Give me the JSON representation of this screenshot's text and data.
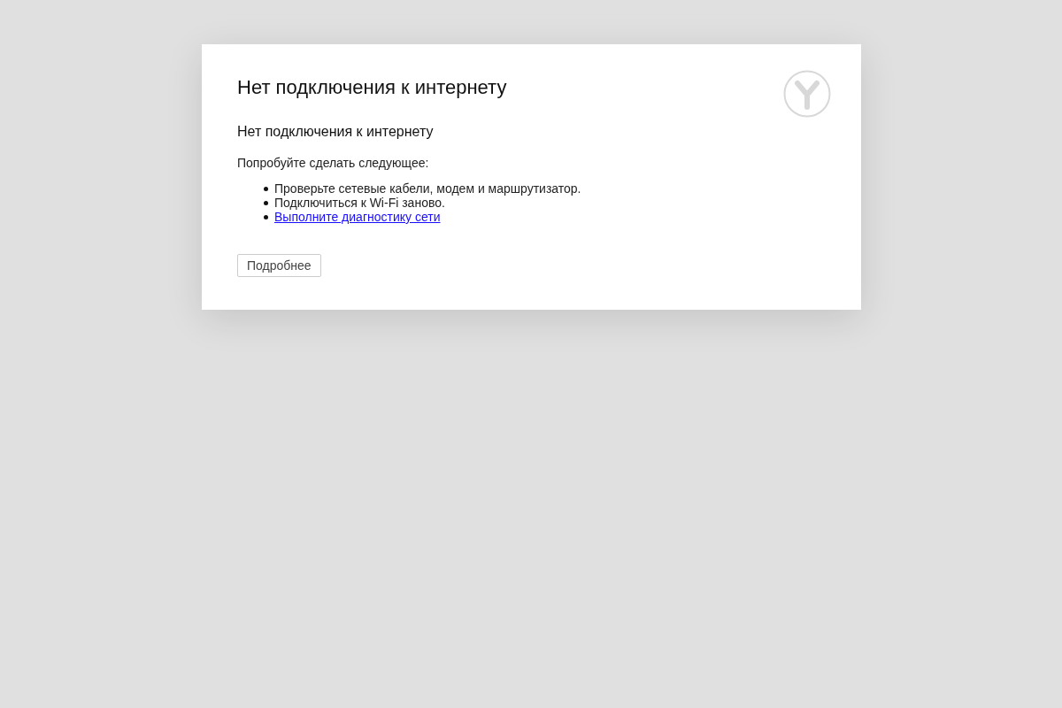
{
  "title": "Нет подключения к интернету",
  "subtitle": "Нет подключения к интернету",
  "intro": "Попробуйте сделать следующее:",
  "suggestions": [
    {
      "kind": "text",
      "text": "Проверьте сетевые кабели, модем и маршрутизатор."
    },
    {
      "kind": "text",
      "text": "Подключиться к Wi-Fi заново."
    },
    {
      "kind": "link",
      "text": "Выполните диагностику сети"
    }
  ],
  "details_button": "Подробнее"
}
